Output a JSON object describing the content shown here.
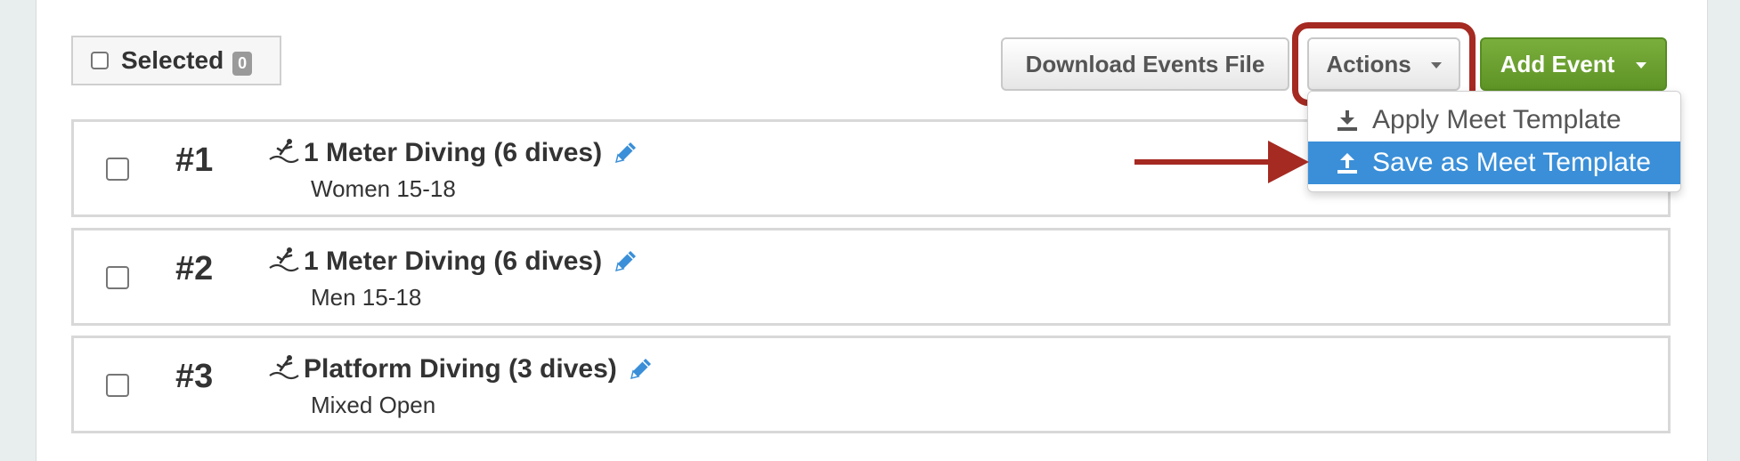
{
  "toolbar": {
    "selected_label": "Selected",
    "selected_count": "0",
    "download_label": "Download Events File",
    "actions_label": "Actions",
    "add_event_label": "Add Event"
  },
  "dropdown": {
    "items": [
      {
        "label": "Apply Meet Template",
        "icon": "download-icon"
      },
      {
        "label": "Save as Meet Template",
        "icon": "upload-icon",
        "highlighted": true
      }
    ]
  },
  "events": [
    {
      "number": "#1",
      "title": "1 Meter Diving (6 dives)",
      "subtitle": "Women 15-18",
      "icon": "diver-icon"
    },
    {
      "number": "#2",
      "title": "1 Meter Diving (6 dives)",
      "subtitle": "Men 15-18",
      "icon": "diver-icon"
    },
    {
      "number": "#3",
      "title": "Platform Diving (3 dives)",
      "subtitle": "Mixed Open",
      "icon": "diver-icon"
    }
  ],
  "colors": {
    "add_event_green": "#6ca232",
    "highlight_blue": "#3a8fd8",
    "annotation_red": "#a52a22",
    "edit_icon_blue": "#3a8fd8"
  }
}
